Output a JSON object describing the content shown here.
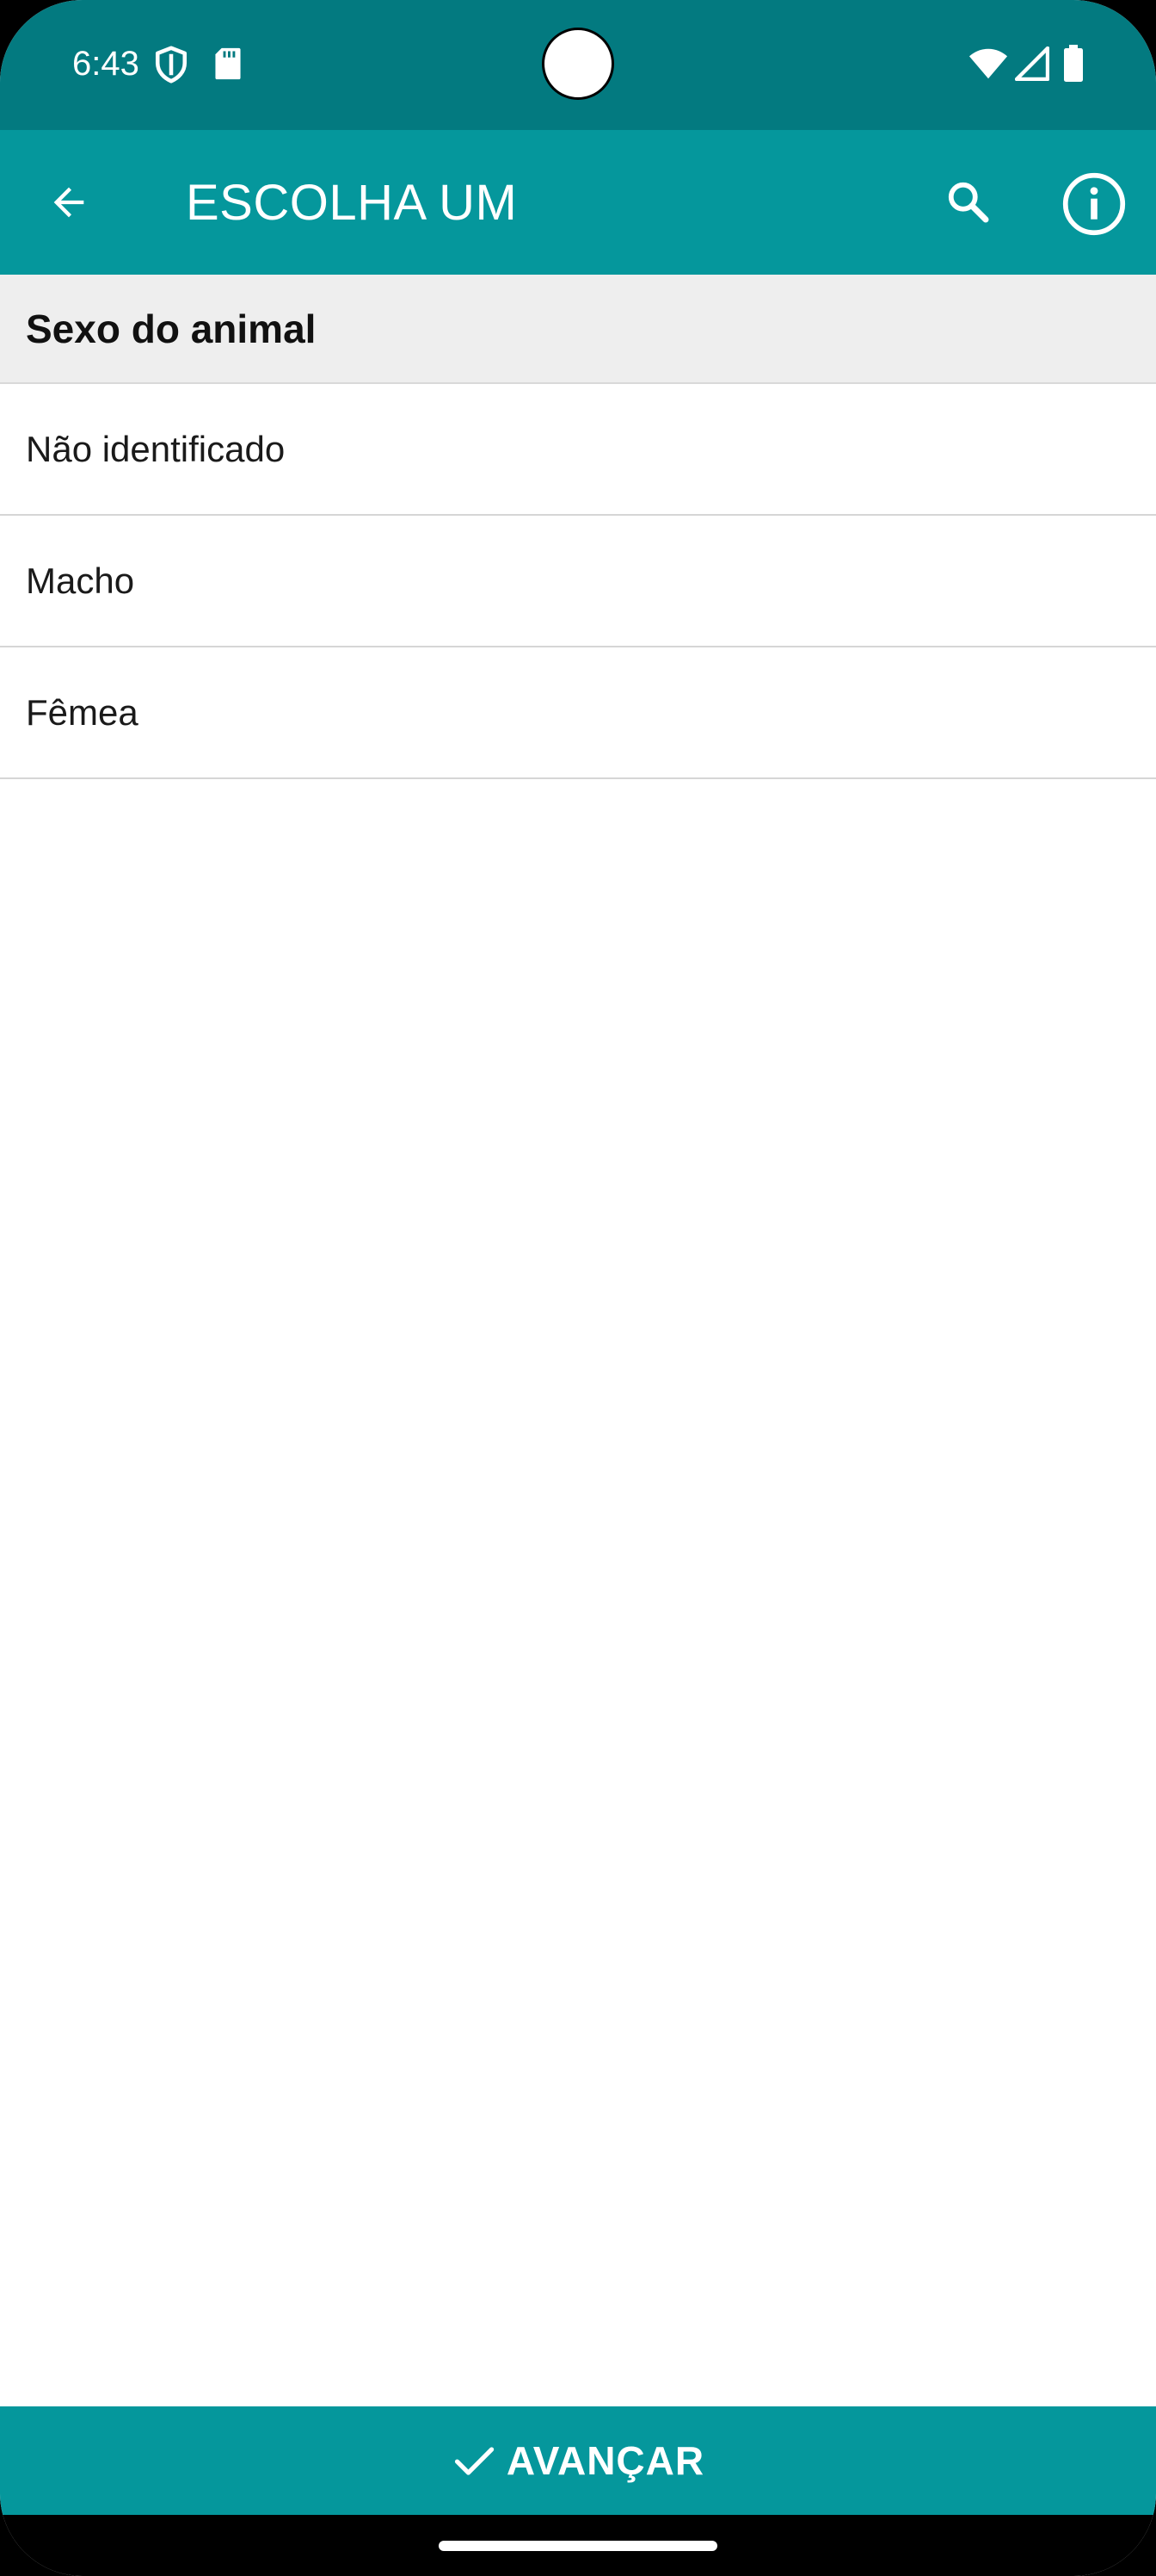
{
  "status_bar": {
    "time": "6:43",
    "icons": [
      "shield-icon",
      "sd-card-icon",
      "wifi-icon",
      "signal-icon",
      "battery-icon"
    ]
  },
  "app_bar": {
    "title": "ESCOLHA UM",
    "back_icon": "arrow-left-icon",
    "search_icon": "search-icon",
    "info_icon": "info-icon"
  },
  "section": {
    "title": "Sexo do animal"
  },
  "options": [
    {
      "label": "Não identificado"
    },
    {
      "label": "Macho"
    },
    {
      "label": "Fêmea"
    }
  ],
  "action": {
    "label": "AVANÇAR",
    "icon": "check-icon"
  },
  "colors": {
    "status_bar": "#037a80",
    "primary": "#05979c",
    "section_bg": "#eeeeee"
  }
}
